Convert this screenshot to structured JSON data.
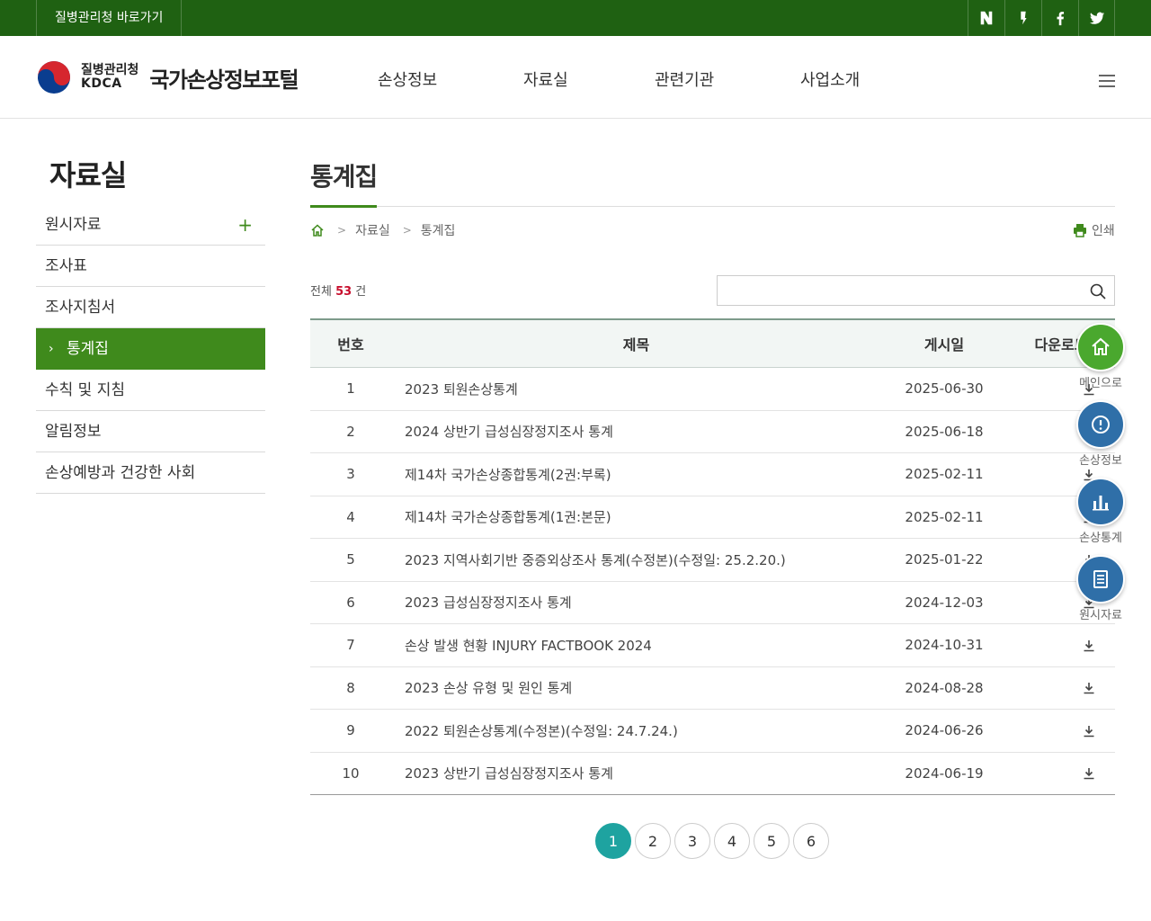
{
  "topbar": {
    "link_label": "질병관리청 바로가기",
    "social": [
      "naver-blog",
      "kakao-story",
      "facebook",
      "twitter"
    ]
  },
  "header": {
    "org_ko": "질병관리청",
    "org_en": "KDCA",
    "site_title": "국가손상정보포털",
    "nav": [
      "손상정보",
      "자료실",
      "관련기관",
      "사업소개"
    ]
  },
  "sidebar": {
    "title": "자료실",
    "items": [
      {
        "label": "원시자료",
        "expandable": true
      },
      {
        "label": "조사표"
      },
      {
        "label": "조사지침서"
      },
      {
        "label": "통계집",
        "active": true
      },
      {
        "label": "수칙 및 지침"
      },
      {
        "label": "알림정보"
      },
      {
        "label": "손상예방과 건강한 사회"
      }
    ]
  },
  "content": {
    "title": "통계집",
    "breadcrumb": [
      "자료실",
      "통계집"
    ],
    "print_label": "인쇄",
    "total_prefix": "전체",
    "total_count": "53",
    "total_suffix": "건",
    "search_placeholder": ""
  },
  "table": {
    "headers": [
      "번호",
      "제목",
      "게시일",
      "다운로드"
    ],
    "rows": [
      {
        "no": "1",
        "title": "2023 퇴원손상통계",
        "date": "2025-06-30"
      },
      {
        "no": "2",
        "title": "2024 상반기 급성심장정지조사 통계",
        "date": "2025-06-18"
      },
      {
        "no": "3",
        "title": "제14차 국가손상종합통계(2권:부록)",
        "date": "2025-02-11"
      },
      {
        "no": "4",
        "title": "제14차 국가손상종합통계(1권:본문)",
        "date": "2025-02-11"
      },
      {
        "no": "5",
        "title": "2023 지역사회기반 중증외상조사 통계(수정본)(수정일: 25.2.20.)",
        "date": "2025-01-22"
      },
      {
        "no": "6",
        "title": "2023 급성심장정지조사 통계",
        "date": "2024-12-03"
      },
      {
        "no": "7",
        "title": "손상 발생 현황 INJURY FACTBOOK 2024",
        "date": "2024-10-31"
      },
      {
        "no": "8",
        "title": "2023 손상 유형 및 원인 통계",
        "date": "2024-08-28"
      },
      {
        "no": "9",
        "title": "2022 퇴원손상통계(수정본)(수정일: 24.7.24.)",
        "date": "2024-06-26"
      },
      {
        "no": "10",
        "title": "2023 상반기 급성심장정지조사 통계",
        "date": "2024-06-19"
      }
    ]
  },
  "pagination": {
    "pages": [
      "1",
      "2",
      "3",
      "4",
      "5",
      "6"
    ],
    "current": "1"
  },
  "quick_menu": [
    {
      "label": "메인으로",
      "icon": "home-icon",
      "color": "#4aa82e"
    },
    {
      "label": "손상정보",
      "icon": "alert-icon",
      "color": "#2f6fa8"
    },
    {
      "label": "손상통계",
      "icon": "bar-chart-icon",
      "color": "#2f6fa8"
    },
    {
      "label": "원시자료",
      "icon": "document-icon",
      "color": "#2f6fa8"
    }
  ],
  "colors": {
    "topbar": "#1f6112",
    "accent_green": "#3f8a1c",
    "count_red": "#c8102e",
    "page_active": "#1ea3a0"
  }
}
